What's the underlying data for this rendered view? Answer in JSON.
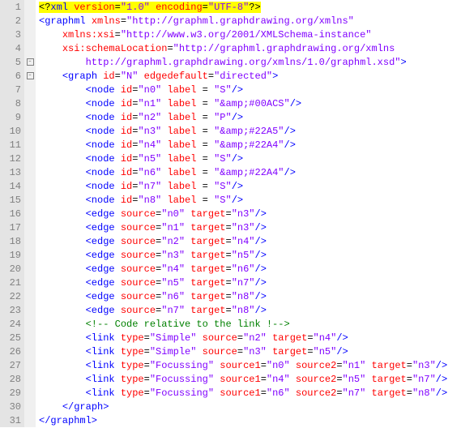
{
  "gutter": [
    "1",
    "2",
    "3",
    "4",
    "5",
    "6",
    "7",
    "8",
    "9",
    "10",
    "11",
    "12",
    "13",
    "14",
    "15",
    "16",
    "17",
    "18",
    "19",
    "20",
    "21",
    "22",
    "23",
    "24",
    "25",
    "26",
    "27",
    "28",
    "29",
    "30",
    "31"
  ],
  "fold": [
    "",
    "",
    "",
    "",
    "-",
    "-",
    "",
    "",
    "",
    "",
    "",
    "",
    "",
    "",
    "",
    "",
    "",
    "",
    "",
    "",
    "",
    "",
    "",
    "",
    "",
    "",
    "",
    "",
    "",
    "",
    ""
  ],
  "lines": {
    "l1": {
      "pre": "",
      "open": "<?",
      "tag": "xml",
      "a1": "version",
      "v1": "\"1.0\"",
      "a2": "encoding",
      "v2": "\"UTF-8\"",
      "close": "?>"
    },
    "l2": {
      "pre": "",
      "tag": "graphml",
      "a1": "xmlns",
      "v1": "\"http://graphml.graphdrawing.org/xmlns\""
    },
    "l3": {
      "pre": "    ",
      "a1": "xmlns:xsi",
      "v1": "\"http://www.w3.org/2001/XMLSchema-instance\""
    },
    "l4": {
      "pre": "    ",
      "a1": "xsi:schemaLocation",
      "v1": "\"http://graphml.graphdrawing.org/xmlns"
    },
    "l5": {
      "pre": "        ",
      "v1": "http://graphml.graphdrawing.org/xmlns/1.0/graphml.xsd\"",
      "close": ">"
    },
    "l6": {
      "pre": "    ",
      "tag": "graph",
      "a1": "id",
      "v1": "\"N\"",
      "a2": "edgedefault",
      "v2": "\"directed\"",
      "close": ">"
    },
    "l7": {
      "pre": "        ",
      "tag": "node",
      "a1": "id",
      "v1": "\"n0\"",
      "a2": "label",
      "eq": " = ",
      "v2": "\"S\"",
      "close": "/>"
    },
    "l8": {
      "pre": "        ",
      "tag": "node",
      "a1": "id",
      "v1": "\"n1\"",
      "a2": "label",
      "eq": " = ",
      "v2": "\"&amp;#00ACS\"",
      "close": "/>"
    },
    "l9": {
      "pre": "        ",
      "tag": "node",
      "a1": "id",
      "v1": "\"n2\"",
      "a2": "label",
      "eq": " = ",
      "v2": "\"P\"",
      "close": "/>"
    },
    "l10": {
      "pre": "        ",
      "tag": "node",
      "a1": "id",
      "v1": "\"n3\"",
      "a2": "label",
      "eq": " = ",
      "v2": "\"&amp;#22A5\"",
      "close": "/>"
    },
    "l11": {
      "pre": "        ",
      "tag": "node",
      "a1": "id",
      "v1": "\"n4\"",
      "a2": "label",
      "eq": " = ",
      "v2": "\"&amp;#22A4\"",
      "close": "/>"
    },
    "l12": {
      "pre": "        ",
      "tag": "node",
      "a1": "id",
      "v1": "\"n5\"",
      "a2": "label",
      "eq": " = ",
      "v2": "\"S\"",
      "close": "/>"
    },
    "l13": {
      "pre": "        ",
      "tag": "node",
      "a1": "id",
      "v1": "\"n6\"",
      "a2": "label",
      "eq": " = ",
      "v2": "\"&amp;#22A4\"",
      "close": "/>"
    },
    "l14": {
      "pre": "        ",
      "tag": "node",
      "a1": "id",
      "v1": "\"n7\"",
      "a2": "label",
      "eq": " = ",
      "v2": "\"S\"",
      "close": "/>"
    },
    "l15": {
      "pre": "        ",
      "tag": "node",
      "a1": "id",
      "v1": "\"n8\"",
      "a2": "label",
      "eq": " = ",
      "v2": "\"S\"",
      "close": "/>"
    },
    "l16": {
      "pre": "        ",
      "tag": "edge",
      "a1": "source",
      "v1": "\"n0\"",
      "a2": "target",
      "v2": "\"n3\"",
      "close": "/>"
    },
    "l17": {
      "pre": "        ",
      "tag": "edge",
      "a1": "source",
      "v1": "\"n1\"",
      "a2": "target",
      "v2": "\"n3\"",
      "close": "/>"
    },
    "l18": {
      "pre": "        ",
      "tag": "edge",
      "a1": "source",
      "v1": "\"n2\"",
      "a2": "target",
      "v2": "\"n4\"",
      "close": "/>"
    },
    "l19": {
      "pre": "        ",
      "tag": "edge",
      "a1": "source",
      "v1": "\"n3\"",
      "a2": "target",
      "v2": "\"n5\"",
      "close": "/>"
    },
    "l20": {
      "pre": "        ",
      "tag": "edge",
      "a1": "source",
      "v1": "\"n4\"",
      "a2": "target",
      "v2": "\"n6\"",
      "close": "/>"
    },
    "l21": {
      "pre": "        ",
      "tag": "edge",
      "a1": "source",
      "v1": "\"n5\"",
      "a2": "target",
      "v2": "\"n7\"",
      "close": "/>"
    },
    "l22": {
      "pre": "        ",
      "tag": "edge",
      "a1": "source",
      "v1": "\"n6\"",
      "a2": "target",
      "v2": "\"n8\"",
      "close": "/>"
    },
    "l23": {
      "pre": "        ",
      "tag": "edge",
      "a1": "source",
      "v1": "\"n7\"",
      "a2": "target",
      "v2": "\"n8\"",
      "close": "/>"
    },
    "l24": {
      "pre": "        ",
      "cmt": "<!-- Code relative to the link !-->"
    },
    "l25": {
      "pre": "        ",
      "tag": "link",
      "a1": "type",
      "v1": "\"Simple\"",
      "a2": "source",
      "v2": "\"n2\"",
      "a3": "target",
      "v3": "\"n4\"",
      "close": "/>"
    },
    "l26": {
      "pre": "        ",
      "tag": "link",
      "a1": "type",
      "v1": "\"Simple\"",
      "a2": "source",
      "v2": "\"n3\"",
      "a3": "target",
      "v3": "\"n5\"",
      "close": "/>"
    },
    "l27": {
      "pre": "        ",
      "tag": "link",
      "a1": "type",
      "v1": "\"Focussing\"",
      "a2": "source1",
      "v2": "\"n0\"",
      "a3": "source2",
      "v3": "\"n1\"",
      "a4": "target",
      "v4": "\"n3\"",
      "close": "/>"
    },
    "l28": {
      "pre": "        ",
      "tag": "link",
      "a1": "type",
      "v1": "\"Focussing\"",
      "a2": "source1",
      "v2": "\"n4\"",
      "a3": "source2",
      "v3": "\"n5\"",
      "a4": "target",
      "v4": "\"n7\"",
      "close": "/>"
    },
    "l29": {
      "pre": "        ",
      "tag": "link",
      "a1": "type",
      "v1": "\"Focussing\"",
      "a2": "source1",
      "v2": "\"n6\"",
      "a3": "source2",
      "v3": "\"n7\"",
      "a4": "target",
      "v4": "\"n8\"",
      "close": "/>"
    },
    "l30": {
      "pre": "    ",
      "endtag": "graph"
    },
    "l31": {
      "pre": "",
      "endtag": "graphml"
    }
  }
}
